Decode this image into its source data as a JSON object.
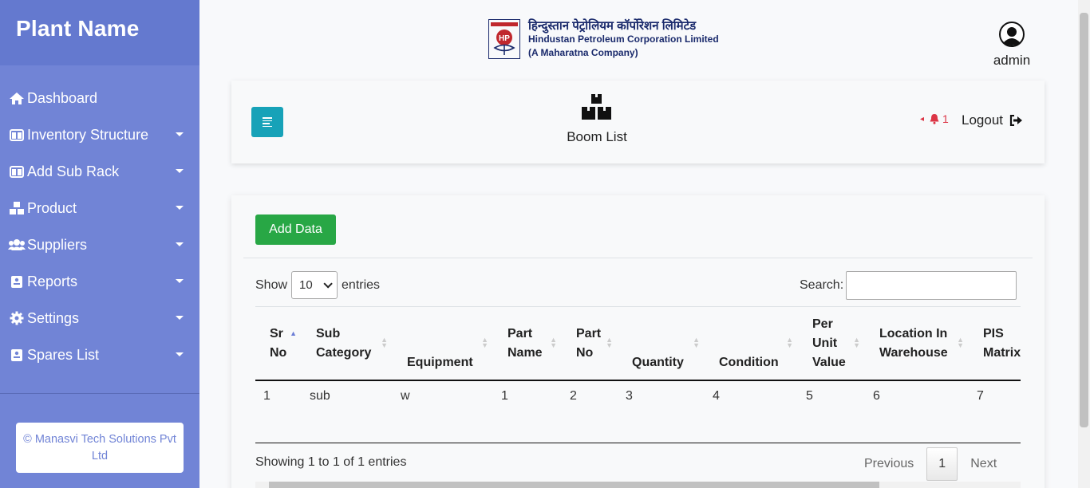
{
  "sidebar": {
    "brand": "Plant Name",
    "items": [
      {
        "label": "Dashboard",
        "icon": "home-icon"
      },
      {
        "label": "Inventory Structure",
        "icon": "columns-icon"
      },
      {
        "label": "Add Sub Rack",
        "icon": "columns-icon"
      },
      {
        "label": "Product",
        "icon": "boxes-icon"
      },
      {
        "label": "Suppliers",
        "icon": "users-icon"
      },
      {
        "label": "Reports",
        "icon": "id-card-icon"
      },
      {
        "label": "Settings",
        "icon": "gear-icon"
      },
      {
        "label": "Spares List",
        "icon": "id-card-icon"
      }
    ],
    "copyright": "© Manasvi Tech Solutions Pvt Ltd"
  },
  "header": {
    "logo_hindi": "हिन्दुस्तान पेट्रोलियम कॉर्पोरेशन लिमिटेड",
    "logo_english": "Hindustan Petroleum Corporation Limited",
    "logo_sub": "(A Maharatna Company)",
    "logo_mark": "HP",
    "user": "admin"
  },
  "topbar": {
    "page_title": "Boom List",
    "notification_count": "1",
    "logout_label": "Logout"
  },
  "main": {
    "add_button": "Add Data",
    "show_label": "Show",
    "page_size": "10",
    "entries_label": "entries",
    "search_label": "Search:",
    "columns": [
      {
        "label": "Sr No"
      },
      {
        "label": "Sub Category"
      },
      {
        "label": "Equipment"
      },
      {
        "label": "Part Name"
      },
      {
        "label": "Part No"
      },
      {
        "label": "Quantity"
      },
      {
        "label": "Condition"
      },
      {
        "label": "Per Unit Value"
      },
      {
        "label": "Location In Warehouse"
      },
      {
        "label": "PIS Matrix"
      }
    ],
    "rows": [
      [
        "1",
        "sub",
        "w",
        "1",
        "2",
        "3",
        "4",
        "5",
        "6",
        "7"
      ]
    ],
    "info": "Showing 1 to 1 of 1 entries",
    "pager": {
      "previous": "Previous",
      "current": "1",
      "next": "Next"
    }
  },
  "colors": {
    "sidebar": "#7184d6",
    "brand_bar": "#6479cf",
    "menu_button": "#17a2b8",
    "add_button": "#28a745",
    "bell": "#dc3545"
  }
}
